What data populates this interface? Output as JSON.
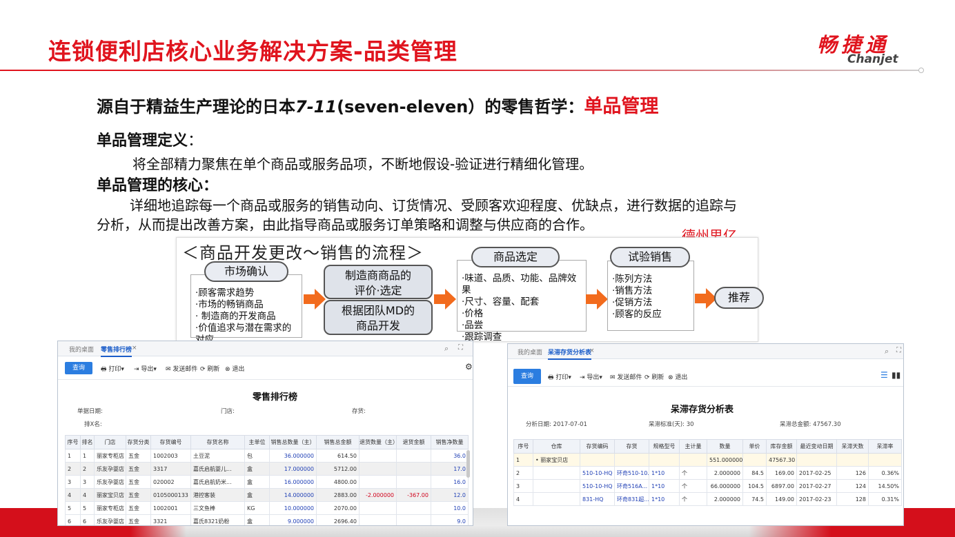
{
  "slide": {
    "title": "连锁便利店核心业务解决方案-品类管理",
    "logo_cn": "畅捷通",
    "logo_en": "Chanjet",
    "headline_pre": "源自于精益生产理论的日本",
    "headline_em": "7-11",
    "headline_mid": "(seven-eleven）的零售哲学：",
    "headline_red": "单品管理",
    "def_head": "单品管理定义",
    "def_colon": "：",
    "def_text": "将全部精力聚焦在单个商品或服务品项，不断地假设-验证进行精细化管理。",
    "core_head": "单品管理的核心：",
    "core_text_1": "详细地追踪每一个商品或服务的销售动向、订货情况、受顾客欢迎程度、优缺点，进行数据的追踪与",
    "core_text_2": "分析，从而提出改善方案，由此指导商品或服务订单策略和调整与供应商的合作。",
    "watermark": "德州思亿"
  },
  "flow": {
    "title": "＜商品开发更改～销售的流程＞",
    "step1_label": "市场确认",
    "step1_items": [
      "·顾客需求趋势",
      "·市场的畅销商品",
      "· 制造商的开发商品",
      "·价值追求与潜在需求的对应"
    ],
    "step2a": [
      "制造商商品的",
      "评价·选定"
    ],
    "step2b": [
      "根据团队MD的",
      "商品开发"
    ],
    "step3_label": "商品选定",
    "step3_items": [
      "·味道、品质、功能、品牌效果",
      "·尺寸、容量、配套",
      "·价格",
      "·品尝",
      "·跟踪调查"
    ],
    "step4_label": "试验销售",
    "step4_items": [
      "·陈列方法",
      "·销售方法",
      "·促销方法",
      "·顾客的反应"
    ],
    "step5_label": "推荐"
  },
  "shot_left": {
    "tab_home": "我的桌面",
    "tab_active": "零售排行榜",
    "tab_close": "×",
    "query_btn": "查询",
    "tools": [
      "打印",
      "导出",
      "发送邮件",
      "刷新",
      "退出"
    ],
    "report_title": "零售排行榜",
    "meta_1": "单据日期:",
    "meta_2": "门店:",
    "meta_3": "存货:",
    "meta_4": "排X名:",
    "columns": [
      "序号",
      "排名",
      "门店",
      "存货分类",
      "存货编号",
      "存货名称",
      "主单位",
      "销售总数量（主）",
      "销售总金额",
      "退货数量（主）",
      "退货金额",
      "销售净数量"
    ],
    "rows": [
      [
        "1",
        "1",
        "丽家专柜店",
        "五金",
        "1002003",
        "土豆泥",
        "包",
        "36.000000",
        "614.50",
        "",
        "",
        "36.0"
      ],
      [
        "2",
        "2",
        "乐友孕婴店",
        "五金",
        "3317",
        "嘉氏启航婴儿...",
        "盒",
        "17.000000",
        "5712.00",
        "",
        "",
        "17.0"
      ],
      [
        "3",
        "3",
        "乐友孕婴店",
        "五金",
        "020002",
        "嘉氏启航奶米...",
        "盒",
        "16.000000",
        "4800.00",
        "",
        "",
        "16.0"
      ],
      [
        "4",
        "4",
        "丽家宝贝店",
        "五金",
        "0105000133",
        "港控客装",
        "盒",
        "14.000000",
        "2883.00",
        "-2.000000",
        "-367.00",
        "12.0"
      ],
      [
        "5",
        "5",
        "丽家专柜店",
        "五金",
        "1002001",
        "三文鱼棒",
        "KG",
        "10.000000",
        "2070.00",
        "",
        "",
        "10.0"
      ],
      [
        "6",
        "6",
        "乐友孕婴店",
        "五金",
        "3321",
        "嘉氏8321奶粉",
        "盒",
        "9.000000",
        "2696.40",
        "",
        "",
        "9.0"
      ]
    ]
  },
  "shot_right": {
    "tab_home": "我的桌面",
    "tab_active": "呆滞存货分析表",
    "tab_close": "×",
    "query_btn": "查询",
    "tools": [
      "打印",
      "导出",
      "发送邮件",
      "刷新",
      "退出"
    ],
    "report_title": "呆滞存货分析表",
    "meta_1": "分析日期: 2017-07-01",
    "meta_2": "呆滞标准(天): 30",
    "meta_3": "呆滞总金额: 47567.30",
    "columns": [
      "序号",
      "仓库",
      "存货编码",
      "存货",
      "规格型号",
      "主计量",
      "数量",
      "单价",
      "库存金额",
      "最近变动日期",
      "呆滞天数",
      "呆滞率"
    ],
    "rows": [
      [
        "1",
        "• 丽家宝贝店",
        "",
        "",
        "",
        "",
        "551.000000",
        "",
        "47567.30",
        "",
        "",
        ""
      ],
      [
        "2",
        "",
        "510-10-HQ",
        "环奇510-10...",
        "1*10",
        "个",
        "2.000000",
        "84.5",
        "169.00",
        "2017-02-25",
        "126",
        "0.36%"
      ],
      [
        "3",
        "",
        "510-10-HQ",
        "环奇516A...",
        "1*10",
        "个",
        "66.000000",
        "104.5",
        "6897.00",
        "2017-02-27",
        "124",
        "14.50%"
      ],
      [
        "4",
        "",
        "831-HQ",
        "环奇831超...",
        "1*10",
        "个",
        "2.000000",
        "74.5",
        "149.00",
        "2017-02-23",
        "128",
        "0.31%"
      ]
    ]
  },
  "colors": {
    "brand_red": "#e0141e",
    "arrow_orange": "#f26b1d",
    "ui_blue": "#2b7de0"
  }
}
